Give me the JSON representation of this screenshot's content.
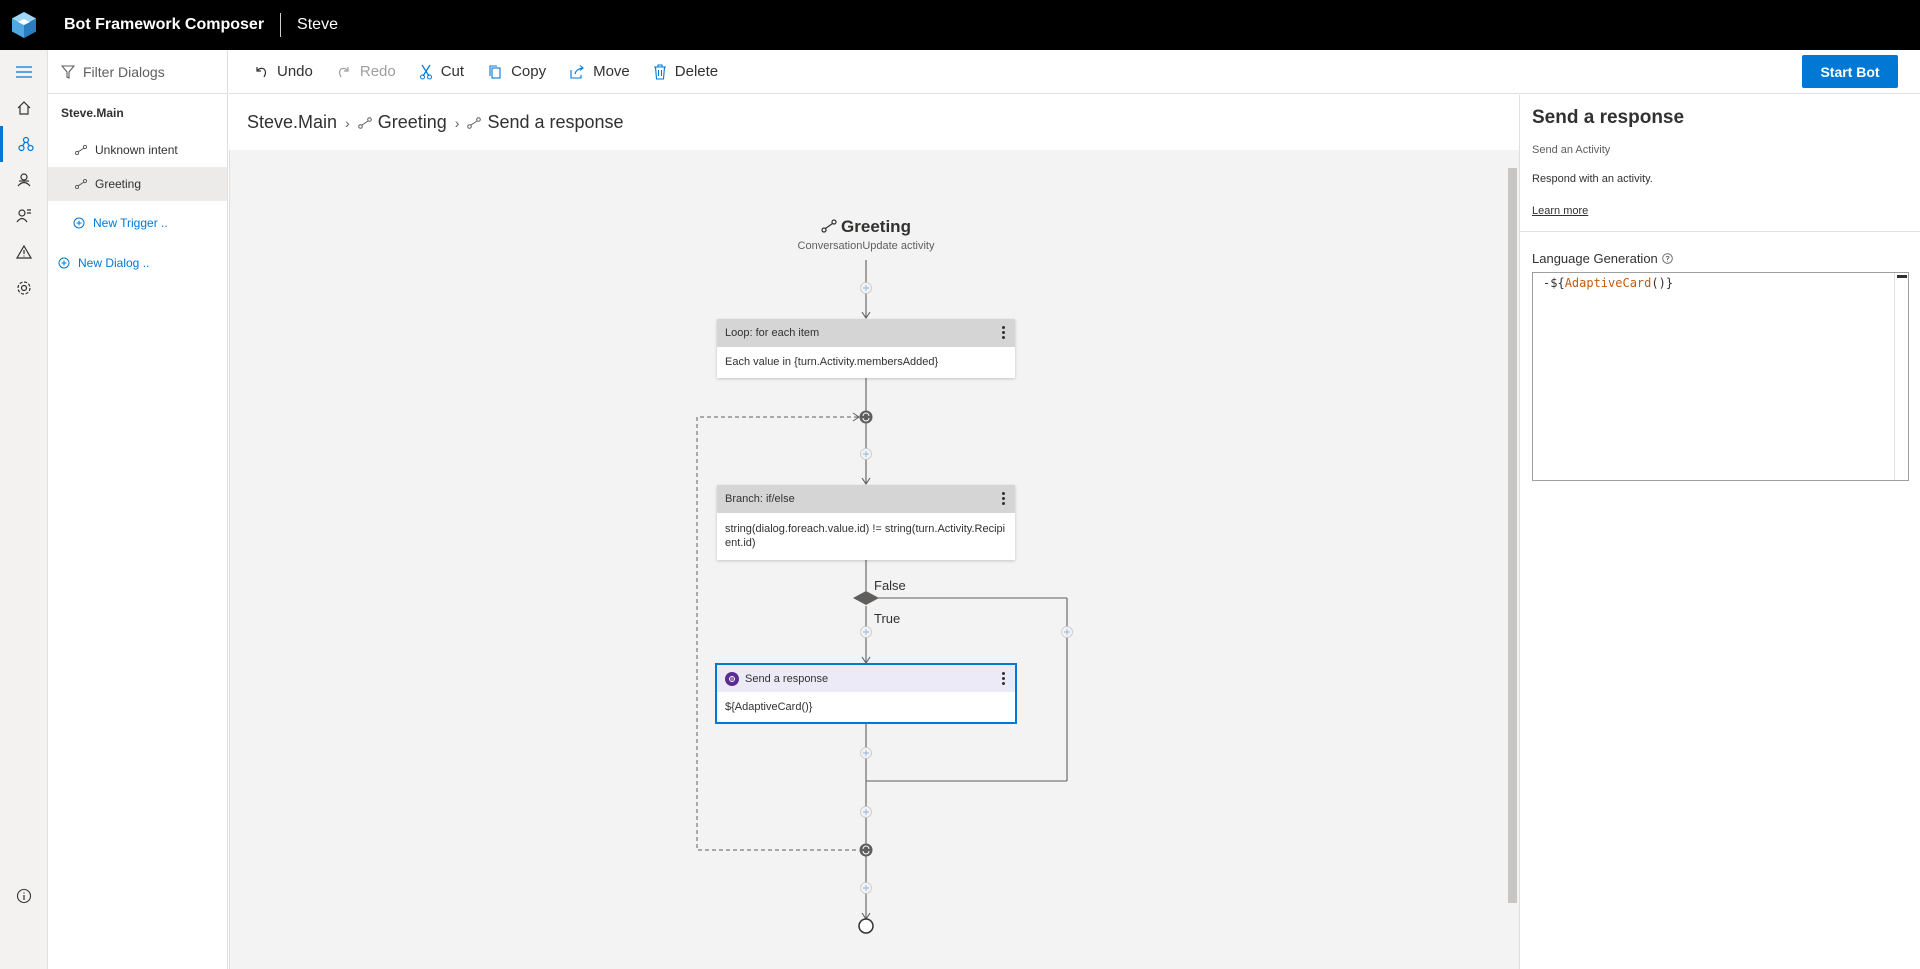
{
  "app": {
    "title": "Bot Framework Composer",
    "bot_name": "Steve"
  },
  "rail": {
    "items": [
      {
        "name": "menu-icon"
      },
      {
        "name": "home-icon"
      },
      {
        "name": "design-icon",
        "active": true
      },
      {
        "name": "bot-responses-icon"
      },
      {
        "name": "user-input-icon"
      },
      {
        "name": "notifications-icon"
      },
      {
        "name": "settings-icon"
      },
      {
        "name": "info-icon"
      }
    ]
  },
  "tree": {
    "filter_placeholder": "Filter Dialogs",
    "dialog_name": "Steve.Main",
    "triggers": [
      {
        "label": "Unknown intent"
      },
      {
        "label": "Greeting",
        "selected": true
      }
    ],
    "new_trigger": "New Trigger ..",
    "new_dialog": "New Dialog .."
  },
  "toolbar": {
    "undo": "Undo",
    "redo": "Redo",
    "cut": "Cut",
    "copy": "Copy",
    "move": "Move",
    "delete": "Delete",
    "start_bot": "Start Bot"
  },
  "breadcrumb": [
    "Steve.Main",
    "Greeting",
    "Send a response"
  ],
  "canvas": {
    "trigger_title": "Greeting",
    "trigger_subtitle": "ConversationUpdate activity",
    "loop_header": "Loop: for each item",
    "loop_body": "Each value in {turn.Activity.membersAdded}",
    "branch_header": "Branch: if/else",
    "branch_body": "string(dialog.foreach.value.id) != string(turn.Activity.Recipient.id)",
    "false_label": "False",
    "true_label": "True",
    "send_header": "Send a response",
    "send_body": "${AdaptiveCard()}"
  },
  "props": {
    "title": "Send a response",
    "subtitle": "Send an Activity",
    "description": "Respond with an activity.",
    "learn_more": "Learn more",
    "lg_label": "Language Generation",
    "lg_prefix": "-${",
    "lg_fn": "AdaptiveCard",
    "lg_suffix": "()}"
  },
  "colors": {
    "accent": "#0078d4",
    "topbar": "#000000",
    "canvas": "#f3f3f3",
    "send_icon": "#5c2d91"
  }
}
